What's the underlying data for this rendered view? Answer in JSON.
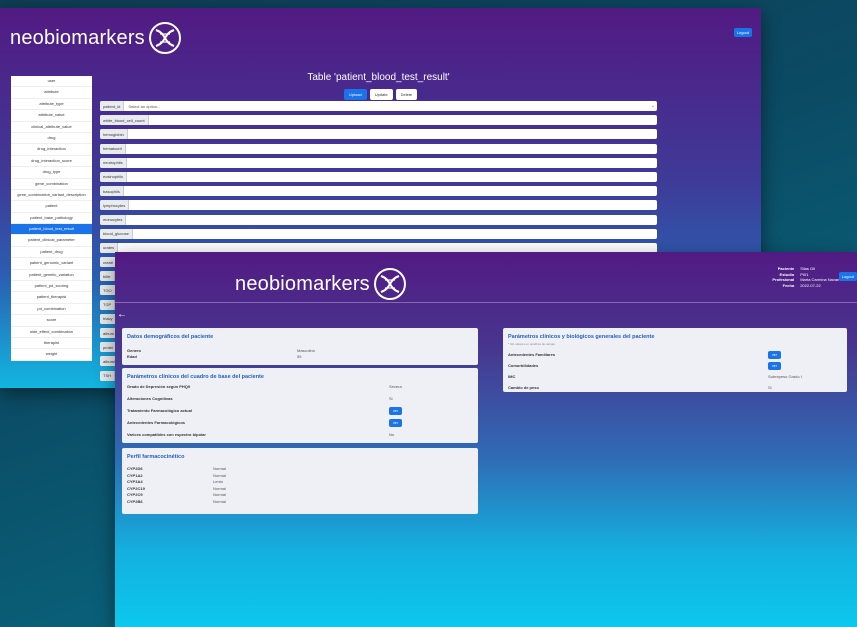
{
  "app": {
    "brand": "neobiomarkers",
    "logout_label": "Logout"
  },
  "admin": {
    "title": "Table 'patient_blood_test_result'",
    "buttons": {
      "upload": "Upload",
      "update": "Update",
      "delete": "Delete"
    },
    "sidebar": [
      "user",
      "attribute",
      "attribute_type",
      "attribute_value",
      "clinical_attribute_value",
      "drug",
      "drug_interaction",
      "drug_interaction_score",
      "drug_type",
      "gene_combination",
      "gene_combination_variant_description",
      "patient",
      "patient_base_pathology",
      "patient_blood_test_result",
      "patient_clinical_parameter",
      "patient_drug",
      "patient_genomic_variant",
      "patient_genetic_variation",
      "patient_pd_scoring",
      "patient_therapist",
      "pd_combination",
      "score",
      "side_effect_combination",
      "therapist",
      "weight"
    ],
    "active_index": 13,
    "select": {
      "label": "patient_id",
      "placeholder": "Select an option..."
    },
    "fields": [
      "white_blood_cell_count",
      "hemoglobin",
      "hematocrit",
      "neutrophils",
      "eosinophils",
      "basophils",
      "lymphocytes",
      "monocytes",
      "blood_glucose",
      "urates",
      "creati",
      "bilirr",
      "TGO",
      "TGP",
      "triacy",
      "album",
      "protei",
      "albumi",
      "TSH"
    ]
  },
  "patient_view": {
    "info": [
      {
        "k": "Paciente",
        "v": "Silas Gil"
      },
      {
        "k": "Estudio",
        "v": "PI01"
      },
      {
        "k": "Profesional",
        "v": "Marta Carmina Navarro"
      },
      {
        "k": "Fecha",
        "v": "2022-07-22"
      }
    ],
    "demographics": {
      "title": "Datos demográficos del paciente",
      "rows": [
        {
          "k": "Genero",
          "v": "Masculino"
        },
        {
          "k": "Edad",
          "v": "55"
        }
      ]
    },
    "clinical_base": {
      "title": "Parámetros clínicos del cuadro de base del paciente",
      "rows": [
        {
          "k": "Grado de Depresión según PHQ9",
          "v": "Severa"
        },
        {
          "k": "Alteraciones Cognitivas",
          "v": "Si"
        },
        {
          "k": "Tratamiento Farmacológico actual",
          "v": "ver"
        },
        {
          "k": "Antecedentes Farmacológicos",
          "v": "ver"
        },
        {
          "k": "Varices compatibles con espectro bipolar",
          "v": "No"
        }
      ]
    },
    "pharmacokinetic": {
      "title": "Perfil farmacocinético",
      "rows": [
        {
          "k": "CYP2D6",
          "v": "Normal"
        },
        {
          "k": "CYP1A2",
          "v": "Normal"
        },
        {
          "k": "CYP3A4",
          "v": "Lento"
        },
        {
          "k": "CYP2C19",
          "v": "Normal"
        },
        {
          "k": "CYP2C9",
          "v": "Normal"
        },
        {
          "k": "CYP2B6",
          "v": "Normal"
        }
      ]
    },
    "clinical_general": {
      "title": "Parámetros clínicos y biológicos generales del paciente",
      "subtitle": "* Sin valores en analítica de sangre",
      "rows": [
        {
          "k": "Antecedentes Familiares",
          "v": "ver"
        },
        {
          "k": "Comorbilidades",
          "v": "ver"
        },
        {
          "k": "IMC",
          "v": "Sobrepeso Grado I"
        },
        {
          "k": "Cambio de peso",
          "v": "Si"
        }
      ]
    },
    "ver_label": "ver",
    "back_icon": "arrow-left-icon"
  }
}
